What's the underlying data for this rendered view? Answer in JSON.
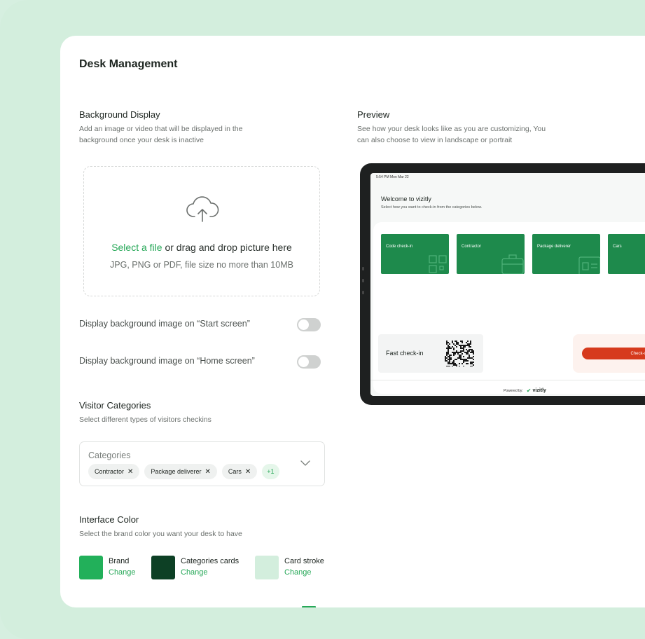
{
  "page": {
    "title": "Desk Management"
  },
  "background": {
    "title": "Background Display",
    "description_line1": "Add an image or video that will be displayed in the",
    "description_line2": "background once your desk is inactive",
    "upload_link": "Select a file",
    "upload_text": " or drag and drop picture here",
    "upload_hint": "JPG, PNG or PDF, file size no more than 10MB",
    "toggle_start_label": "Display background image on “Start screen”",
    "toggle_home_label": "Display background image on “Home screen”"
  },
  "visitor_categories": {
    "title": "Visitor Categories",
    "description": "Select different types of visitors checkins",
    "placeholder": "Categories",
    "chips": [
      "Contractor",
      "Package deliverer",
      "Cars"
    ],
    "more_count": "+1",
    "remove_glyph": "✕"
  },
  "interface_color": {
    "title": "Interface Color",
    "description": "Select the brand color you want your desk to have",
    "swatches": [
      {
        "name": "Brand",
        "change": "Change",
        "color": "#22b05a"
      },
      {
        "name": "Categories cards",
        "change": "Change",
        "color": "#0d4025"
      },
      {
        "name": "Card stroke",
        "change": "Change",
        "color": "#d3eedd"
      }
    ]
  },
  "preview": {
    "title": "Preview",
    "description_line1": "See how your desk looks like as you are customizing, You",
    "description_line2": "can also choose to view in landscape or portrait",
    "status_time": "5:54 PM   Mon Mar 22",
    "welcome_title": "Welcome to vizitly",
    "welcome_sub": "Select how you want to check-in from the categories below.",
    "tiles": [
      "Code check-in",
      "Contractor",
      "Package deliverer",
      "Cars"
    ],
    "fast_checkin": "Fast check-in",
    "checkout": "Check-out here",
    "powered_by": "Powered by:",
    "brand_name": "vizitly"
  }
}
